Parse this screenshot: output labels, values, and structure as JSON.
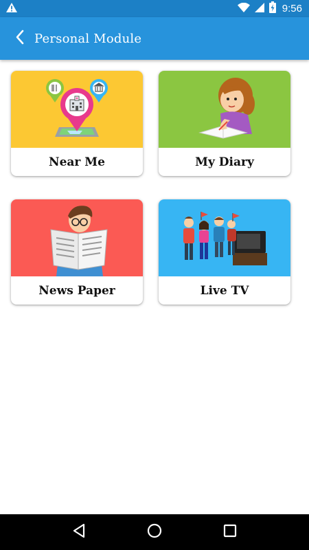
{
  "status_bar": {
    "time": "9:56",
    "icons": [
      "warning-icon",
      "wifi-icon",
      "signal-icon",
      "battery-charging-icon"
    ]
  },
  "app_bar": {
    "title": "Personal Module",
    "back_icon": "chevron-left-icon",
    "background": "#2793dc",
    "status_background": "#1c80c6"
  },
  "modules": [
    {
      "label": "Near Me",
      "color": "#fcc833",
      "icon": "map-pins-illustration"
    },
    {
      "label": "My Diary",
      "color": "#8bc641",
      "icon": "girl-writing-illustration"
    },
    {
      "label": "News Paper",
      "color": "#fb5a54",
      "icon": "boy-reading-newspaper-illustration"
    },
    {
      "label": "Live TV",
      "color": "#37b5f3",
      "icon": "people-watching-tv-illustration"
    }
  ],
  "nav_bar": {
    "buttons": [
      "back-triangle-icon",
      "home-circle-icon",
      "recents-square-icon"
    ]
  }
}
